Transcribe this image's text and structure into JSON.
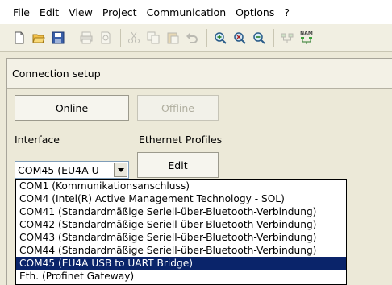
{
  "menubar": {
    "items": [
      "File",
      "Edit",
      "View",
      "Project",
      "Communication",
      "Options",
      "?"
    ]
  },
  "toolbar": {
    "icons": [
      "new-icon",
      "open-icon",
      "save-icon",
      "print-icon",
      "print-preview-icon",
      "cut-icon",
      "copy-icon",
      "paste-icon",
      "undo-icon",
      "zoom-in-icon",
      "zoom-fit-icon",
      "zoom-out-icon",
      "network-icon",
      "nam-network-icon"
    ],
    "nam_label": "NAM"
  },
  "panel": {
    "title": "Connection setup",
    "online_label": "Online",
    "offline_label": "Offline",
    "interface_label": "Interface",
    "ethernet_label": "Ethernet Profiles",
    "edit_label": "Edit",
    "combo_value": "COM45 (EU4A U"
  },
  "dropdown": {
    "options": [
      "COM1 (Kommunikationsanschluss)",
      "COM4 (Intel(R) Active Management Technology - SOL)",
      "COM41 (Standardmäßige Seriell-über-Bluetooth-Verbindung)",
      "COM42 (Standardmäßige Seriell-über-Bluetooth-Verbindung)",
      "COM43 (Standardmäßige Seriell-über-Bluetooth-Verbindung)",
      "COM44 (Standardmäßige Seriell-über-Bluetooth-Verbindung)",
      "COM45 (EU4A USB to UART Bridge)",
      "Eth. (Profinet Gateway)"
    ],
    "selected_index": 6
  },
  "colors": {
    "selection": "#0a246a",
    "window_bg": "#ece9d8",
    "combo_border": "#7f9db9"
  }
}
